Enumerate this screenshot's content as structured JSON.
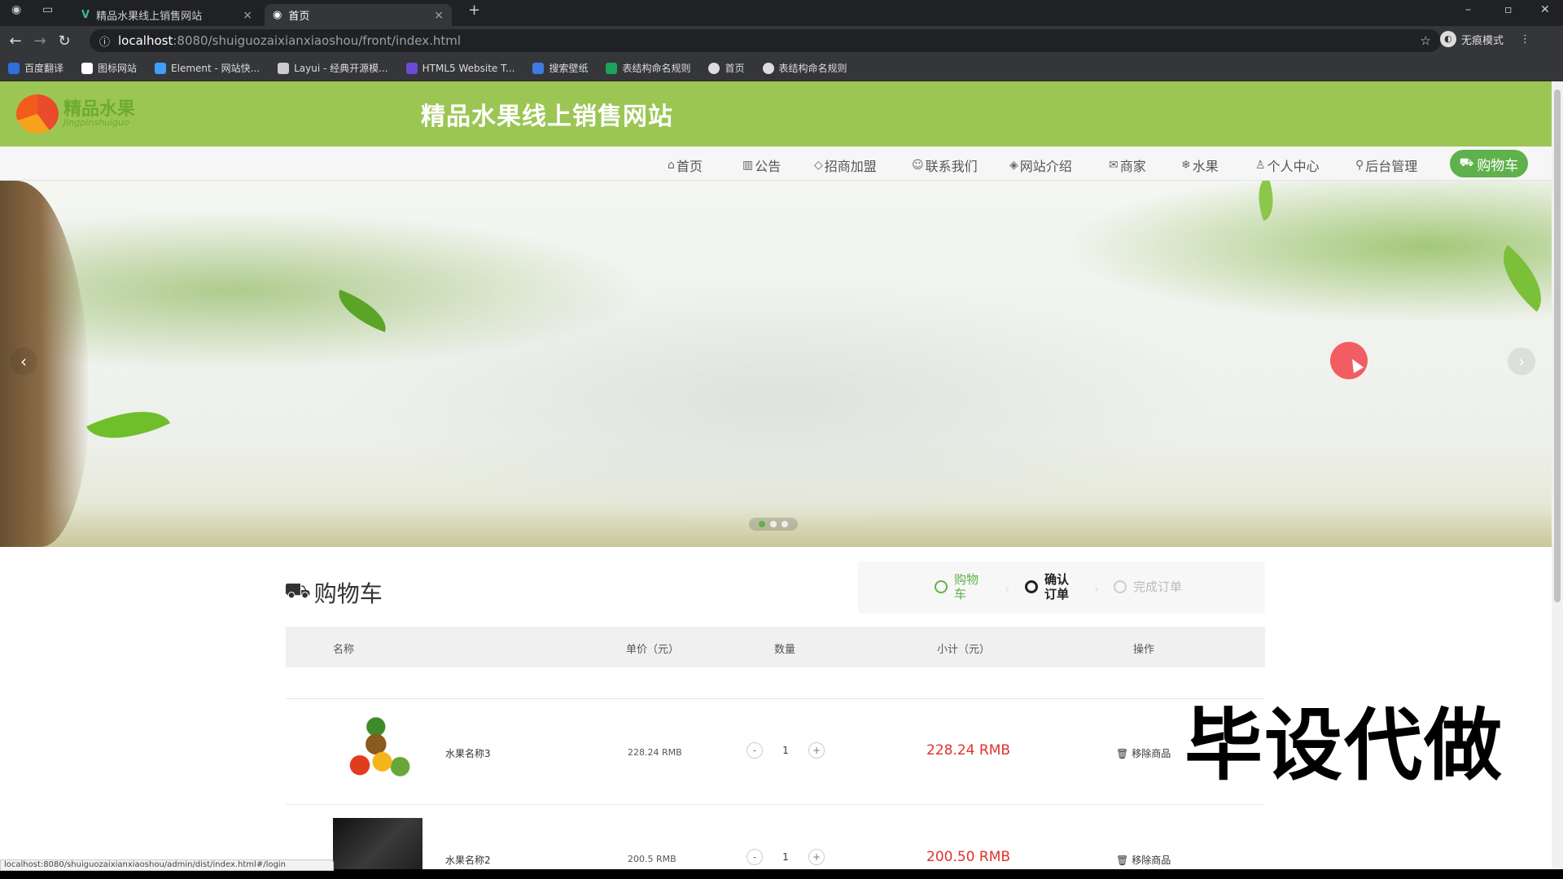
{
  "browser": {
    "tabs": [
      {
        "title": "精品水果线上销售网站",
        "close": "×"
      },
      {
        "title": "首页",
        "close": "×"
      }
    ],
    "new_tab": "+",
    "url_host": "localhost",
    "url_path": ":8080/shuiguozaixianxiaoshou/front/index.html",
    "profile_label": "无痕模式",
    "bookmarks": [
      {
        "label": "百度翻译",
        "color": "#2f6fdf"
      },
      {
        "label": "图标网站",
        "color": "#ffffff"
      },
      {
        "label": "Element - 网站快...",
        "color": "#409eff"
      },
      {
        "label": "Layui - 经典开源模...",
        "color": "#cccccc"
      },
      {
        "label": "HTML5 Website T...",
        "color": "#6c4cd6"
      },
      {
        "label": "搜索壁纸",
        "color": "#3d7be0"
      },
      {
        "label": "表结构命名规则",
        "color": "#1ea35a"
      },
      {
        "label": "首页",
        "color": "#dddddd"
      },
      {
        "label": "表结构命名规则",
        "color": "#dddddd"
      }
    ]
  },
  "header": {
    "logo_text": "精品水果",
    "logo_sub": "Jingpinshuiguo",
    "title": "精品水果线上销售网站"
  },
  "nav": {
    "items": [
      {
        "icon": "⌂",
        "label": "首页"
      },
      {
        "icon": "▥",
        "label": "公告"
      },
      {
        "icon": "◇",
        "label": "招商加盟"
      },
      {
        "icon": "☺",
        "label": "联系我们"
      },
      {
        "icon": "◈",
        "label": "网站介绍"
      },
      {
        "icon": "✉",
        "label": "商家"
      },
      {
        "icon": "❄",
        "label": "水果"
      },
      {
        "icon": "♙",
        "label": "个人中心"
      },
      {
        "icon": "⚲",
        "label": "后台管理"
      }
    ],
    "cart_label": "购物车",
    "cart_icon": "🛒"
  },
  "banner": {
    "prev": "‹",
    "next": "›",
    "slide_count": 3,
    "active_slide": 1
  },
  "cart": {
    "title": "购物车",
    "steps": [
      {
        "label": "购物车",
        "state": "done"
      },
      {
        "label": "确认订单",
        "state": "current"
      },
      {
        "label": "完成订单",
        "state": "todo"
      }
    ],
    "columns": [
      "名称",
      "单价（元）",
      "数量",
      "小计（元）",
      "操作"
    ],
    "items": [
      {
        "name": "水果名称3",
        "price": "228.24 RMB",
        "qty": "1",
        "subtotal": "228.24 RMB",
        "remove": "移除商品"
      },
      {
        "name": "水果名称2",
        "price": "200.5 RMB",
        "qty": "1",
        "subtotal": "200.50 RMB",
        "remove": "移除商品"
      }
    ]
  },
  "watermark": "毕设代做",
  "status_url": "localhost:8080/shuiguozaixianxiaoshou/admin/dist/index.html#/login"
}
